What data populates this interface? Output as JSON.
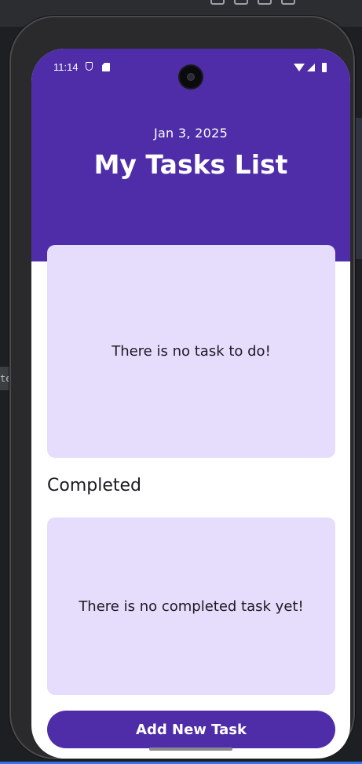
{
  "status_bar": {
    "time": "11:14"
  },
  "header": {
    "date": "Jan 3, 2025",
    "title": "My Tasks List"
  },
  "todo_card": {
    "empty_message": "There is no task to do!"
  },
  "completed_section": {
    "label": "Completed",
    "empty_message": "There is no completed task yet!"
  },
  "add_button": {
    "label": "Add New Task"
  },
  "ide": {
    "left_tab_text": "te"
  },
  "colors": {
    "primary": "#4f2da8",
    "card_background": "#e6ddfd",
    "text_dark": "#1c1a22",
    "header_text": "#ffffff"
  }
}
